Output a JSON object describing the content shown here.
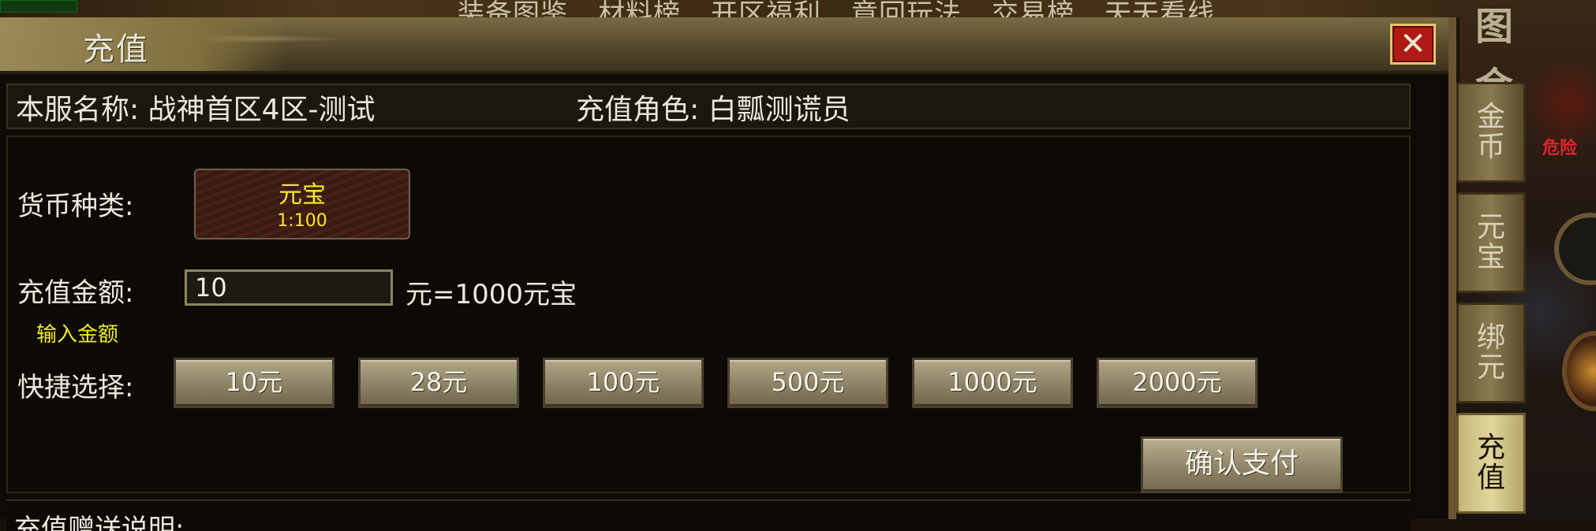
{
  "game_top": {
    "corner_text": "",
    "menu_items": [
      "装备图鉴",
      "材料榜",
      "开区福利",
      "章回玩法",
      "交易榜",
      "天天看线"
    ]
  },
  "game_right": {
    "danger_text": "危险",
    "glyph_top": "图",
    "glyph_mid": "金"
  },
  "dialog": {
    "title": "充值",
    "close_label": "✕"
  },
  "info": {
    "server_label": "本服名称: 战神首区4区-测试",
    "role_label": "充值角色: 白瓢测谎员"
  },
  "form": {
    "currency_type_label": "货币种类:",
    "currency_option": {
      "name": "元宝",
      "ratio": "1:100"
    },
    "amount_label": "充值金额:",
    "amount_value": "10",
    "amount_hint": "输入金额",
    "amount_result": "元=1000元宝",
    "quick_label": "快捷选择:",
    "quick_options": [
      "10元",
      "28元",
      "100元",
      "500元",
      "1000元",
      "2000元"
    ],
    "confirm_label": "确认支付"
  },
  "footer": {
    "label": "充值赠送说明:"
  },
  "side_tabs": [
    {
      "line1": "金",
      "line2": "币"
    },
    {
      "line1": "元",
      "line2": "宝"
    },
    {
      "line1": "绑",
      "line2": "元"
    },
    {
      "line1": "充",
      "line2": "值"
    }
  ],
  "colors": {
    "highlight_text": "#f2ec20",
    "close_button": "#b01a14",
    "danger_text": "#e8232a"
  }
}
